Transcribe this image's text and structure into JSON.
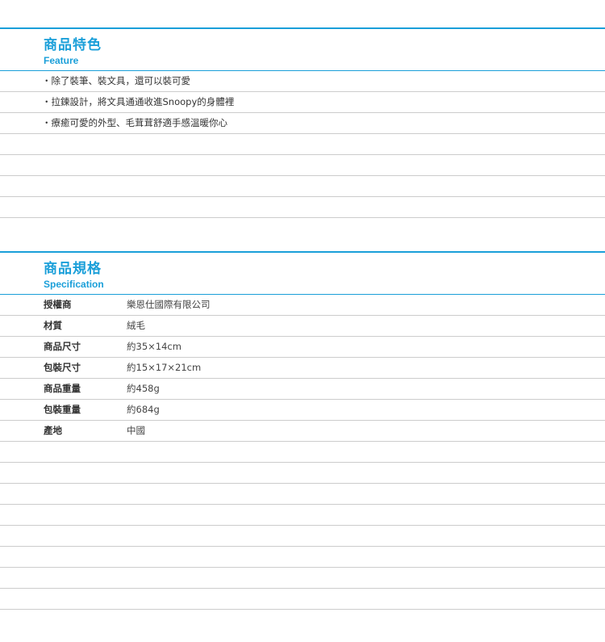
{
  "feature": {
    "title_zh": "商品特色",
    "title_en": "Feature",
    "items": [
      "・除了裝筆、裝文具，還可以裝可愛",
      "・拉鍊設計，將文具通通收進Snoopy的身體裡",
      "・療癒可愛的外型、毛茸茸舒適手感溫暖你心",
      "",
      "",
      "",
      "",
      ""
    ]
  },
  "spec": {
    "title_zh": "商品規格",
    "title_en": "Specification",
    "rows": [
      {
        "label": "授權商",
        "value": "樂恩仕國際有限公司"
      },
      {
        "label": "材質",
        "value": "絨毛"
      },
      {
        "label": "商品尺寸",
        "value": "約35×14cm"
      },
      {
        "label": "包裝尺寸",
        "value": "約15×17×21cm"
      },
      {
        "label": "商品重量",
        "value": "約458g"
      },
      {
        "label": "包裝重量",
        "value": "約684g"
      },
      {
        "label": "產地",
        "value": "中國"
      },
      {
        "label": "",
        "value": ""
      },
      {
        "label": "",
        "value": ""
      },
      {
        "label": "",
        "value": ""
      },
      {
        "label": "",
        "value": ""
      },
      {
        "label": "",
        "value": ""
      },
      {
        "label": "",
        "value": ""
      },
      {
        "label": "",
        "value": ""
      },
      {
        "label": "",
        "value": ""
      }
    ]
  },
  "colors": {
    "accent": "#1a9fd9",
    "divider": "#cccccc"
  }
}
